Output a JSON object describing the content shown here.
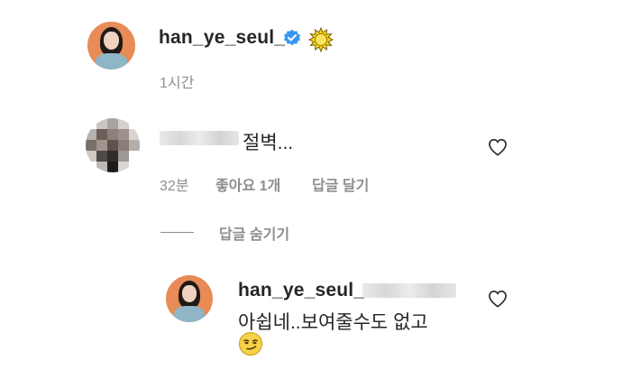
{
  "post": {
    "username": "han_ye_seul_",
    "time": "1시간"
  },
  "comment": {
    "text": "절벽...",
    "time": "32분",
    "likes": "좋아요 1개",
    "reply_label": "답글 달기"
  },
  "replies_toggle": {
    "label": "답글 숨기기"
  },
  "reply": {
    "username": "han_ye_seul_",
    "text_line1": "아쉽네..보여줄수도 없고",
    "emoji": "😏"
  },
  "colors": {
    "verified": "#3897f0",
    "avatar_bg": "#e88b56",
    "meta": "#8e8e8e"
  }
}
